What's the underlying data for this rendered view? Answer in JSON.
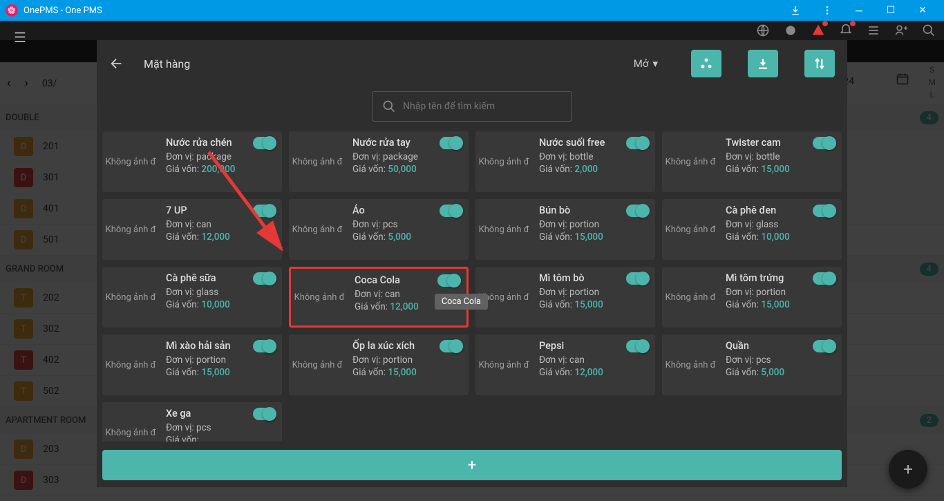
{
  "window": {
    "title": "OnePMS - One PMS"
  },
  "bg": {
    "date": "03/",
    "date_right": "24",
    "sections": [
      {
        "name": "DOUBLE",
        "count": "4",
        "rooms": [
          {
            "badge": "D",
            "cls": "d2",
            "num": "201"
          },
          {
            "badge": "D",
            "cls": "d",
            "num": "301"
          },
          {
            "badge": "D",
            "cls": "d2",
            "num": "401"
          },
          {
            "badge": "D",
            "cls": "d2",
            "num": "501"
          }
        ]
      },
      {
        "name": "GRAND ROOM",
        "count": "4",
        "rooms": [
          {
            "badge": "T",
            "cls": "t",
            "num": "202"
          },
          {
            "badge": "T",
            "cls": "t",
            "num": "302"
          },
          {
            "badge": "T",
            "cls": "d",
            "num": "402"
          },
          {
            "badge": "T",
            "cls": "t",
            "num": "502"
          }
        ]
      },
      {
        "name": "APARTMENT ROOM",
        "count": "2",
        "rooms": [
          {
            "badge": "D",
            "cls": "d2",
            "num": "203"
          },
          {
            "badge": "D",
            "cls": "d",
            "num": "303"
          }
        ]
      }
    ]
  },
  "modal": {
    "title": "Mặt hàng",
    "dropdown": "Mở",
    "search_placeholder": "Nhập tên để tìm kiếm",
    "no_image": "Không ảnh đ",
    "unit_prefix": "Đơn vị: ",
    "cost_prefix": "Giá vốn: ",
    "tooltip": "Coca Cola",
    "items": [
      {
        "name": "Nước rửa chén",
        "unit": "package",
        "cost": "200,000"
      },
      {
        "name": "Nước rửa tay",
        "unit": "package",
        "cost": "50,000"
      },
      {
        "name": "Nước suối free",
        "unit": "bottle",
        "cost": "2,000"
      },
      {
        "name": "Twister cam",
        "unit": "bottle",
        "cost": "15,000"
      },
      {
        "name": "7 UP",
        "unit": "can",
        "cost": "12,000"
      },
      {
        "name": "Áo",
        "unit": "pcs",
        "cost": "5,000"
      },
      {
        "name": "Bún bò",
        "unit": "portion",
        "cost": "15,000"
      },
      {
        "name": "Cà phê đen",
        "unit": "glass",
        "cost": "10,000"
      },
      {
        "name": "Cà phê sữa",
        "unit": "glass",
        "cost": "10,000"
      },
      {
        "name": "Coca Cola",
        "unit": "can",
        "cost": "12,000",
        "highlight": true,
        "showTooltip": true
      },
      {
        "name": "Mì tôm bò",
        "unit": "portion",
        "cost": "15,000"
      },
      {
        "name": "Mì tôm trứng",
        "unit": "portion",
        "cost": "15,000"
      },
      {
        "name": "Mì xào hải sản",
        "unit": "portion",
        "cost": "15,000"
      },
      {
        "name": "Ốp la xúc xích",
        "unit": "portion",
        "cost": "15,000"
      },
      {
        "name": "Pepsi",
        "unit": "can",
        "cost": "12,000"
      },
      {
        "name": "Quần",
        "unit": "pcs",
        "cost": "5,000"
      },
      {
        "name": "Xe ga",
        "unit": "pcs",
        "cost": ""
      }
    ]
  },
  "sml": {
    "s": "S",
    "m": "M",
    "l": "L"
  }
}
